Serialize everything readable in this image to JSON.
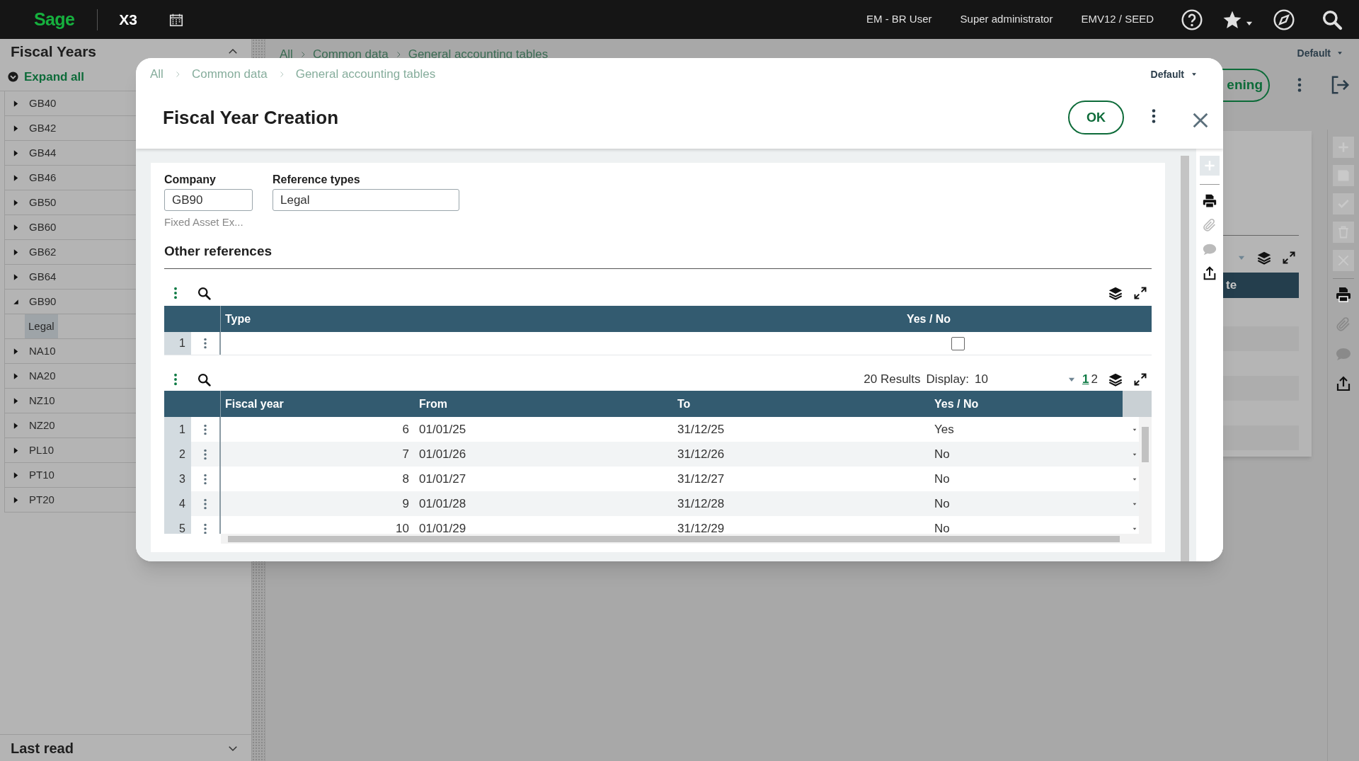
{
  "top_bar": {
    "brand": "Sage",
    "app": "X3",
    "user": "EM - BR User",
    "role": "Super administrator",
    "folder": "EMV12 / SEED"
  },
  "sidebar": {
    "title": "Fiscal Years",
    "expand_all": "Expand all",
    "items": [
      {
        "label": "GB40",
        "expanded": false,
        "selected": false
      },
      {
        "label": "GB42",
        "expanded": false,
        "selected": false
      },
      {
        "label": "GB44",
        "expanded": false,
        "selected": false
      },
      {
        "label": "GB46",
        "expanded": false,
        "selected": false
      },
      {
        "label": "GB50",
        "expanded": false,
        "selected": false
      },
      {
        "label": "GB60",
        "expanded": false,
        "selected": false
      },
      {
        "label": "GB62",
        "expanded": false,
        "selected": false
      },
      {
        "label": "GB64",
        "expanded": false,
        "selected": false
      },
      {
        "label": "GB90",
        "expanded": true,
        "selected": false,
        "children": [
          {
            "label": "Legal",
            "selected": true
          }
        ]
      },
      {
        "label": "NA10",
        "expanded": false,
        "selected": false
      },
      {
        "label": "NA20",
        "expanded": false,
        "selected": false
      },
      {
        "label": "NZ10",
        "expanded": false,
        "selected": false
      },
      {
        "label": "NZ20",
        "expanded": false,
        "selected": false
      },
      {
        "label": "PL10",
        "expanded": false,
        "selected": false
      },
      {
        "label": "PT10",
        "expanded": false,
        "selected": false
      },
      {
        "label": "PT20",
        "expanded": false,
        "selected": false
      }
    ],
    "footer": "Last read"
  },
  "background": {
    "breadcrumb": [
      "All",
      "Common data",
      "General accounting tables"
    ],
    "view": "Default",
    "action_button": "ening",
    "table_header": "te"
  },
  "dialog": {
    "breadcrumb": [
      "All",
      "Common data",
      "General accounting tables"
    ],
    "view": "Default",
    "title": "Fiscal Year Creation",
    "ok_button": "OK",
    "fields": [
      {
        "label": "Company",
        "value": "GB90",
        "description": "Fixed Asset Ex..."
      },
      {
        "label": "Reference types",
        "value": "Legal"
      }
    ],
    "section": "Other references",
    "references_table": {
      "columns": [
        "Type",
        "Yes / No"
      ],
      "rows": [
        {
          "number": "1",
          "checked": false
        }
      ]
    },
    "years_table": {
      "results": "20 Results",
      "display_label": "Display:",
      "display_value": "10",
      "pages": [
        {
          "label": "1",
          "selected": true
        },
        {
          "label": "2",
          "selected": false
        }
      ],
      "columns": [
        "Fiscal year",
        "From",
        "To",
        "Yes / No"
      ],
      "rows": [
        {
          "number": "1",
          "fiscal_year": "6",
          "from": "01/01/25",
          "to": "31/12/25",
          "yes_no": "Yes"
        },
        {
          "number": "2",
          "fiscal_year": "7",
          "from": "01/01/26",
          "to": "31/12/26",
          "yes_no": "No"
        },
        {
          "number": "3",
          "fiscal_year": "8",
          "from": "01/01/27",
          "to": "31/12/27",
          "yes_no": "No"
        },
        {
          "number": "4",
          "fiscal_year": "9",
          "from": "01/01/28",
          "to": "31/12/28",
          "yes_no": "No"
        },
        {
          "number": "5",
          "fiscal_year": "10",
          "from": "01/01/29",
          "to": "31/12/29",
          "yes_no": "No"
        }
      ]
    }
  }
}
